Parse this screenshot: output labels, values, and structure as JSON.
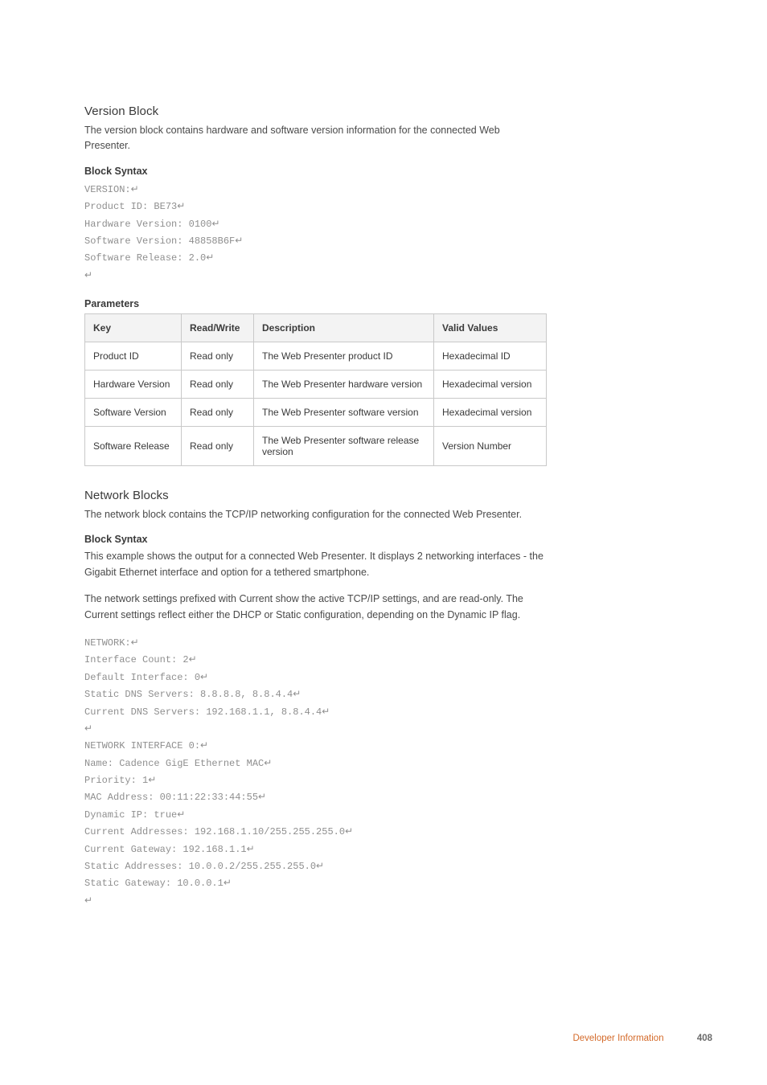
{
  "section1": {
    "title": "Version Block",
    "intro": "The version block contains hardware and software version information for the connected Web Presenter.",
    "block_syntax_heading": "Block Syntax",
    "code_lines": [
      "VERSION:",
      "Product ID: BE73",
      "Hardware Version: 0100",
      "Software Version: 48858B6F",
      "Software Release: 2.0",
      ""
    ],
    "params_heading": "Parameters",
    "table": {
      "headers": [
        "Key",
        "Read/Write",
        "Description",
        "Valid Values"
      ],
      "rows": [
        [
          "Product ID",
          "Read only",
          "The Web Presenter product ID",
          "Hexadecimal ID"
        ],
        [
          "Hardware Version",
          "Read only",
          "The Web Presenter hardware version",
          "Hexadecimal version"
        ],
        [
          "Software Version",
          "Read only",
          "The Web Presenter software version",
          "Hexadecimal version"
        ],
        [
          "Software Release",
          "Read only",
          "The Web Presenter software release version",
          "Version Number"
        ]
      ]
    }
  },
  "section2": {
    "title": "Network Blocks",
    "intro": "The network block contains the TCP/IP networking configuration for the connected Web Presenter.",
    "block_syntax_heading": "Block Syntax",
    "para1": "This example shows the output for a connected Web Presenter. It displays 2 networking interfaces - the Gigabit Ethernet interface and option for a tethered smartphone.",
    "para2": "The network settings prefixed with Current show the active TCP/IP settings, and are read-only. The Current settings reflect either the DHCP or Static configuration, depending on the Dynamic IP flag.",
    "code_lines": [
      "NETWORK:",
      "Interface Count: 2",
      "Default Interface: 0",
      "Static DNS Servers: 8.8.8.8, 8.8.4.4",
      "Current DNS Servers: 192.168.1.1, 8.8.4.4",
      "",
      "NETWORK INTERFACE 0:",
      "Name: Cadence GigE Ethernet MAC",
      "Priority: 1",
      "MAC Address: 00:11:22:33:44:55",
      "Dynamic IP: true",
      "Current Addresses: 192.168.1.10/255.255.255.0",
      "Current Gateway: 192.168.1.1",
      "Static Addresses: 10.0.0.2/255.255.255.0",
      "Static Gateway: 10.0.0.1",
      ""
    ]
  },
  "footer": {
    "label": "Developer Information",
    "page": "408"
  },
  "glyphs": {
    "return": "↵"
  }
}
